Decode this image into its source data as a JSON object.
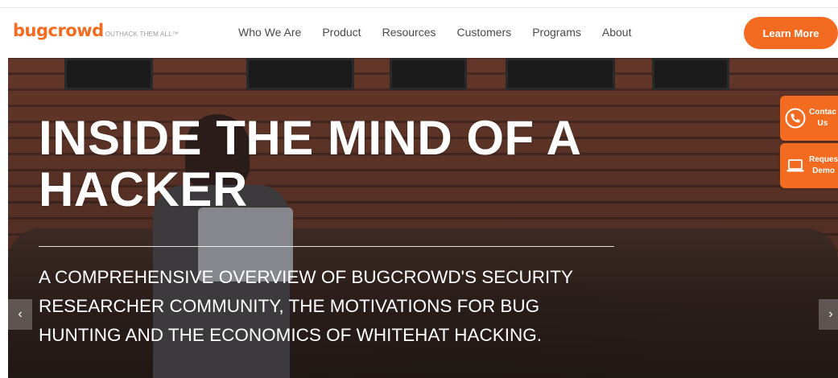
{
  "brand": {
    "name": "bugcrowd",
    "tagline": "OUTHACK THEM ALL™",
    "accent_color": "#f26b21"
  },
  "nav": {
    "items": [
      {
        "label": "Who We Are"
      },
      {
        "label": "Product"
      },
      {
        "label": "Resources"
      },
      {
        "label": "Customers"
      },
      {
        "label": "Programs"
      },
      {
        "label": "About"
      }
    ]
  },
  "cta": {
    "label": "Learn More"
  },
  "hero": {
    "headline": "INSIDE THE MIND OF A HACKER",
    "subheadline": "A COMPREHENSIVE OVERVIEW OF BUGCROWD'S SECURITY RESEARCHER COMMUNITY, THE MOTIVATIONS FOR BUG HUNTING AND THE ECONOMICS OF WHITEHAT HACKING."
  },
  "side_tabs": [
    {
      "label_line1": "Contac",
      "label_line2": "Us",
      "icon": "phone-icon"
    },
    {
      "label_line1": "Reques",
      "label_line2": "Demo",
      "icon": "laptop-icon"
    }
  ],
  "carousel": {
    "prev_icon": "chevron-left-icon",
    "next_icon": "chevron-right-icon"
  }
}
